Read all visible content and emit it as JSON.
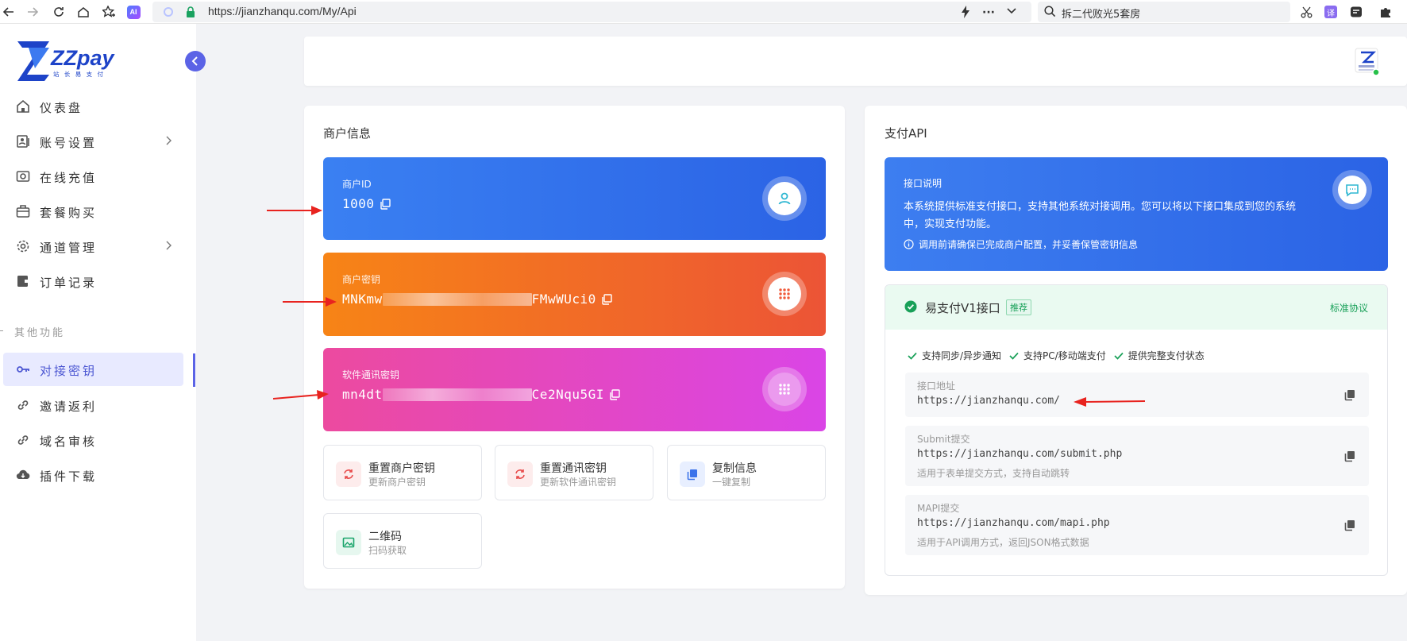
{
  "browser": {
    "url": "https://jianzhanqu.com/My/Api",
    "search_text": "拆二代败光5套房"
  },
  "sidebar": {
    "logo_text": "ZZpay",
    "logo_subtitle": "站 长 易 支 付",
    "items": [
      {
        "label": "仪表盘",
        "icon": "home-icon"
      },
      {
        "label": "账号设置",
        "icon": "account-icon",
        "has_submenu": true
      },
      {
        "label": "在线充值",
        "icon": "camera-icon"
      },
      {
        "label": "套餐购买",
        "icon": "briefcase-icon"
      },
      {
        "label": "通道管理",
        "icon": "gear-icon",
        "has_submenu": true
      },
      {
        "label": "订单记录",
        "icon": "wallet-icon"
      }
    ],
    "section_label": "其他功能",
    "other_items": [
      {
        "label": "对接密钥",
        "icon": "key-icon",
        "active": true
      },
      {
        "label": "邀请返利",
        "icon": "link-icon"
      },
      {
        "label": "域名审核",
        "icon": "link-icon"
      },
      {
        "label": "插件下载",
        "icon": "cloud-download-icon"
      }
    ]
  },
  "merchant": {
    "title": "商户信息",
    "cards": [
      {
        "label": "商户ID",
        "value": "1000",
        "color": "#2f6ef0"
      },
      {
        "label": "商户密钥",
        "value_start": "MNKmw",
        "value_end": "FMwWUci0",
        "color": "#f47a1f"
      },
      {
        "label": "软件通讯密钥",
        "value_start": "mn4dt",
        "value_end": "Ce2Nqu5GI",
        "color": "#e64aa8"
      }
    ],
    "actions": [
      {
        "title": "重置商户密钥",
        "subtitle": "更新商户密钥"
      },
      {
        "title": "重置通讯密钥",
        "subtitle": "更新软件通讯密钥"
      },
      {
        "title": "复制信息",
        "subtitle": "一键复制"
      },
      {
        "title": "二维码",
        "subtitle": "扫码获取"
      }
    ]
  },
  "api": {
    "title": "支付API",
    "info": {
      "title": "接口说明",
      "desc_line1": "本系统提供标准支付接口，支持其他系统对接调用。您可以将以下接口集成到您的系统",
      "desc_line2": "中，实现支付功能。",
      "note": "调用前请确保已完成商户配置，并妥善保管密钥信息"
    },
    "v1": {
      "title": "易支付V1接口",
      "badge": "推荐",
      "protocol": "标准协议",
      "features": [
        "支持同步/异步通知",
        "支持PC/移动端支付",
        "提供完整支付状态"
      ],
      "endpoints": [
        {
          "label": "接口地址",
          "url": "https://jianzhanqu.com/",
          "desc": ""
        },
        {
          "label": "Submit提交",
          "url": "https://jianzhanqu.com/submit.php",
          "desc": "适用于表单提交方式，支持自动跳转"
        },
        {
          "label": "MAPI提交",
          "url": "https://jianzhanqu.com/mapi.php",
          "desc": "适用于API调用方式，返回JSON格式数据"
        }
      ]
    }
  },
  "colors": {
    "accent": "#5b63e6",
    "blue": "#2f6ef0",
    "orange": "#f47a1f",
    "pink": "#e64aa8",
    "green": "#18a058",
    "arrow": "#e8231f"
  }
}
